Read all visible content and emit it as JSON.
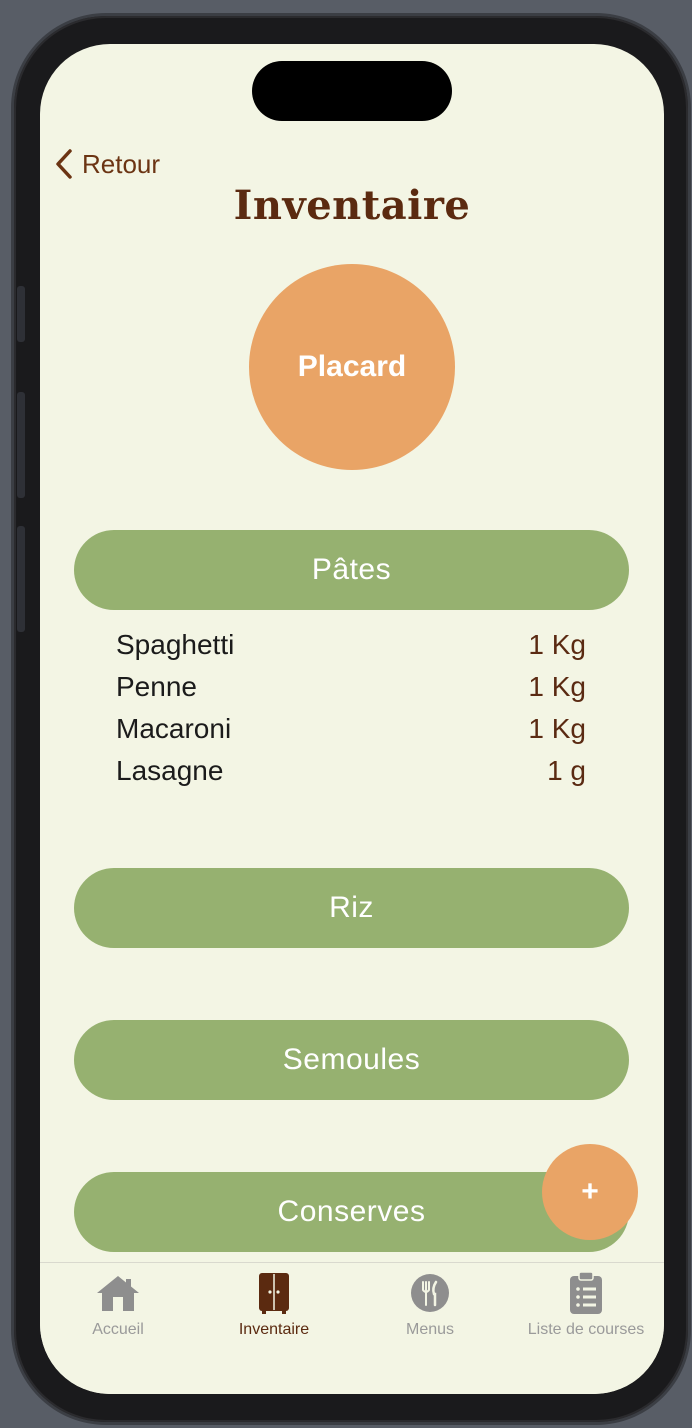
{
  "nav": {
    "back_label": "Retour"
  },
  "page": {
    "title": "Inventaire"
  },
  "location": {
    "label": "Placard"
  },
  "categories": [
    {
      "label": "Pâtes"
    },
    {
      "label": "Riz"
    },
    {
      "label": "Semoules"
    },
    {
      "label": "Conserves"
    }
  ],
  "items": [
    {
      "name": "Spaghetti",
      "qty": "1 Kg"
    },
    {
      "name": "Penne",
      "qty": "1 Kg"
    },
    {
      "name": "Macaroni",
      "qty": "1 Kg"
    },
    {
      "name": "Lasagne",
      "qty": "1 g"
    }
  ],
  "fab": {
    "label": "+"
  },
  "tabs": [
    {
      "label": "Accueil",
      "icon": "house-icon"
    },
    {
      "label": "Inventaire",
      "icon": "cupboard-icon",
      "active": true
    },
    {
      "label": "Menus",
      "icon": "fork-knife-icon"
    },
    {
      "label": "Liste de courses",
      "icon": "clipboard-list-icon"
    }
  ],
  "colors": {
    "background": "#f3f5e4",
    "accent_orange": "#e9a466",
    "category_green": "#96b170",
    "brown": "#5b2a10"
  }
}
